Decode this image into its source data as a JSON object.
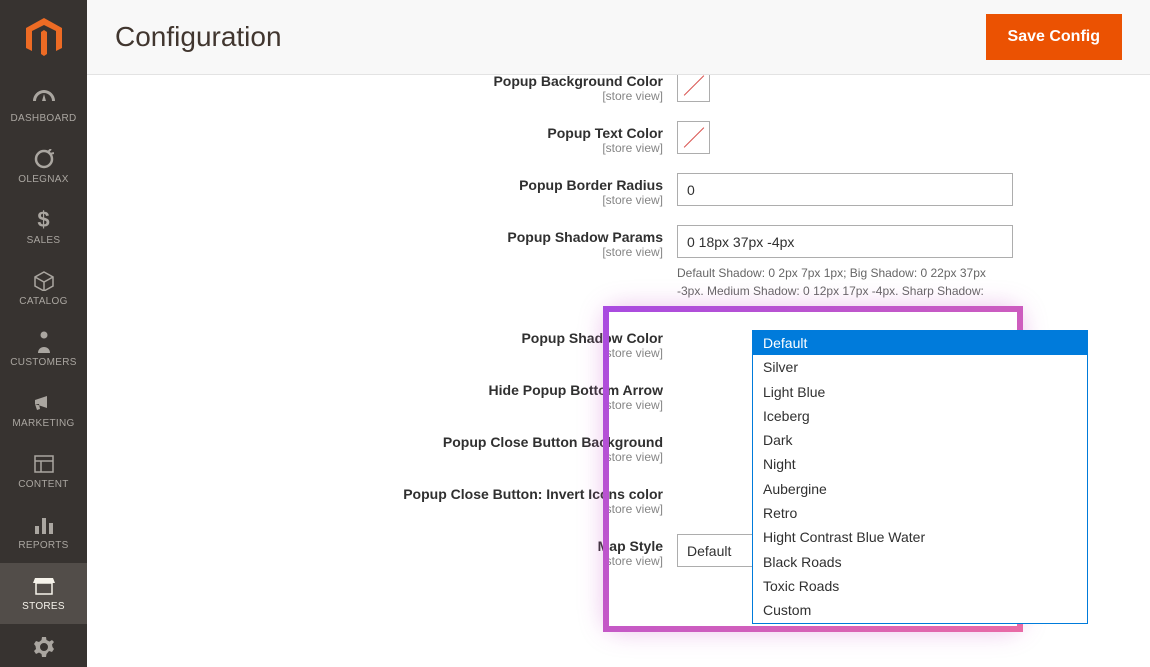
{
  "header": {
    "title": "Configuration",
    "save_btn": "Save Config"
  },
  "sidebar": {
    "items": [
      {
        "label": "DASHBOARD"
      },
      {
        "label": "OLEGNAX"
      },
      {
        "label": "SALES"
      },
      {
        "label": "CATALOG"
      },
      {
        "label": "CUSTOMERS"
      },
      {
        "label": "MARKETING"
      },
      {
        "label": "CONTENT"
      },
      {
        "label": "REPORTS"
      },
      {
        "label": "STORES"
      }
    ]
  },
  "fields": {
    "popup_bg_color": {
      "label": "Popup Background Color",
      "scope": "[store view]"
    },
    "popup_text_color": {
      "label": "Popup Text Color",
      "scope": "[store view]"
    },
    "popup_border_radius": {
      "label": "Popup Border Radius",
      "scope": "[store view]",
      "value": "0"
    },
    "popup_shadow_params": {
      "label": "Popup Shadow Params",
      "scope": "[store view]",
      "value": "0 18px 37px -4px",
      "note": "Default Shadow: 0 2px 7px 1px; Big Shadow: 0 22px 37px -3px. Medium Shadow: 0 12px 17px -4px. Sharp Shadow:"
    },
    "popup_shadow_color": {
      "label": "Popup Shadow Color",
      "scope": "[store view]"
    },
    "hide_popup_arrow": {
      "label": "Hide Popup Bottom Arrow",
      "scope": "[store view]"
    },
    "popup_close_bg": {
      "label": "Popup Close Button Background",
      "scope": "[store view]"
    },
    "popup_close_invert": {
      "label": "Popup Close Button: Invert Icons color",
      "scope": "[store view]"
    },
    "map_style": {
      "label": "Map Style",
      "scope": "[store view]",
      "value": "Default"
    }
  },
  "map_style_options": [
    "Default",
    "Silver",
    "Light Blue",
    "Iceberg",
    "Dark",
    "Night",
    "Aubergine",
    "Retro",
    "Hight Contrast Blue Water",
    "Black Roads",
    "Toxic Roads",
    "Custom"
  ],
  "icons": {
    "arrow_down": "▾"
  }
}
